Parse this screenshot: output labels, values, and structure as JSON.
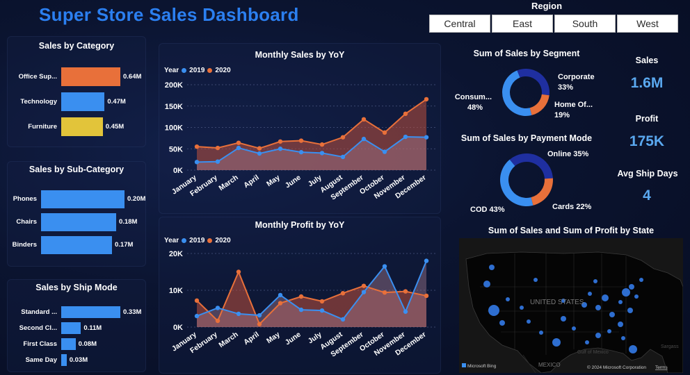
{
  "dashboard": {
    "title": "Super Store Sales Dashboard",
    "region_label": "Region",
    "regions": [
      "Central",
      "East",
      "South",
      "West"
    ]
  },
  "kpis": {
    "sales_label": "Sales",
    "sales_value": "1.6M",
    "profit_label": "Profit",
    "profit_value": "175K",
    "ship_label": "Avg Ship Days",
    "ship_value": "4"
  },
  "legend": {
    "year_label": "Year",
    "y2019": "2019",
    "y2020": "2020"
  },
  "colors": {
    "blue": "#3a8ff0",
    "orange": "#e8703a",
    "yellow": "#e2c43a",
    "navy": "#1f2fa0",
    "title_blue": "#2b7ff0"
  },
  "map": {
    "title": "Sum of Sales and Sum of Profit by State",
    "country_label": "UNITED STATES",
    "mexico_label": "MEXICO",
    "gulf_label": "Gulf of Mexico",
    "sargasso_label": "Sargass",
    "bing_label": "Microsoft Bing",
    "copyright": "© 2024 Microsoft Corporation",
    "terms": "Terms"
  },
  "chart_data": [
    {
      "id": "category",
      "type": "bar",
      "orientation": "horizontal",
      "title": "Sales by Category",
      "categories": [
        "Office Sup...",
        "Technology",
        "Furniture"
      ],
      "values": [
        0.64,
        0.47,
        0.45
      ],
      "value_labels": [
        "0.64M",
        "0.47M",
        "0.45M"
      ],
      "colors": [
        "#e8703a",
        "#3a8ff0",
        "#e2c43a"
      ]
    },
    {
      "id": "subcategory",
      "type": "bar",
      "orientation": "horizontal",
      "title": "Sales by Sub-Category",
      "categories": [
        "Phones",
        "Chairs",
        "Binders"
      ],
      "values": [
        0.2,
        0.18,
        0.17
      ],
      "value_labels": [
        "0.20M",
        "0.18M",
        "0.17M"
      ]
    },
    {
      "id": "shipmode",
      "type": "bar",
      "orientation": "horizontal",
      "title": "Sales by Ship Mode",
      "categories": [
        "Standard ...",
        "Second Cl...",
        "First Class",
        "Same Day"
      ],
      "values": [
        0.33,
        0.11,
        0.08,
        0.03
      ],
      "value_labels": [
        "0.33M",
        "0.11M",
        "0.08M",
        "0.03M"
      ]
    },
    {
      "id": "monthly_sales",
      "type": "area",
      "title": "Monthly Sales by YoY",
      "x": [
        "January",
        "February",
        "March",
        "April",
        "May",
        "June",
        "July",
        "August",
        "September",
        "October",
        "November",
        "December"
      ],
      "ylim": [
        0,
        200000
      ],
      "yticks": [
        "0K",
        "50K",
        "100K",
        "150K",
        "200K"
      ],
      "series": [
        {
          "name": "2019",
          "values": [
            19000,
            20000,
            52000,
            39000,
            50000,
            42000,
            40000,
            31000,
            73000,
            43000,
            78000,
            77000
          ]
        },
        {
          "name": "2020",
          "values": [
            55000,
            52000,
            64000,
            51000,
            67000,
            69000,
            60000,
            77000,
            119000,
            88000,
            132000,
            166000
          ]
        }
      ]
    },
    {
      "id": "monthly_profit",
      "type": "area",
      "title": "Monthly Profit by YoY",
      "x": [
        "January",
        "February",
        "March",
        "April",
        "May",
        "June",
        "July",
        "August",
        "September",
        "October",
        "November",
        "December"
      ],
      "ylim": [
        0,
        20000
      ],
      "yticks": [
        "0K",
        "10K",
        "20K"
      ],
      "series": [
        {
          "name": "2019",
          "values": [
            3000,
            5200,
            3600,
            3200,
            8700,
            4700,
            4500,
            2100,
            9500,
            16500,
            4200,
            18000
          ]
        },
        {
          "name": "2020",
          "values": [
            7200,
            1700,
            15000,
            800,
            6500,
            8300,
            7000,
            9200,
            11200,
            9400,
            9700,
            8500
          ]
        }
      ]
    },
    {
      "id": "segment",
      "type": "pie",
      "title": "Sum of Sales by Segment",
      "labels": [
        "Consum...",
        "Corporate",
        "Home Of..."
      ],
      "values": [
        48,
        33,
        19
      ],
      "value_labels": [
        "48%",
        "33%",
        "19%"
      ],
      "colors": [
        "#3a8ff0",
        "#1f2fa0",
        "#e8703a"
      ]
    },
    {
      "id": "payment",
      "type": "pie",
      "title": "Sum of Sales by Payment Mode",
      "labels": [
        "COD",
        "Online",
        "Cards"
      ],
      "values": [
        43,
        35,
        22
      ],
      "value_labels": [
        "43%",
        "35%",
        "22%"
      ],
      "colors": [
        "#3a8ff0",
        "#1f2fa0",
        "#e8703a"
      ]
    }
  ]
}
